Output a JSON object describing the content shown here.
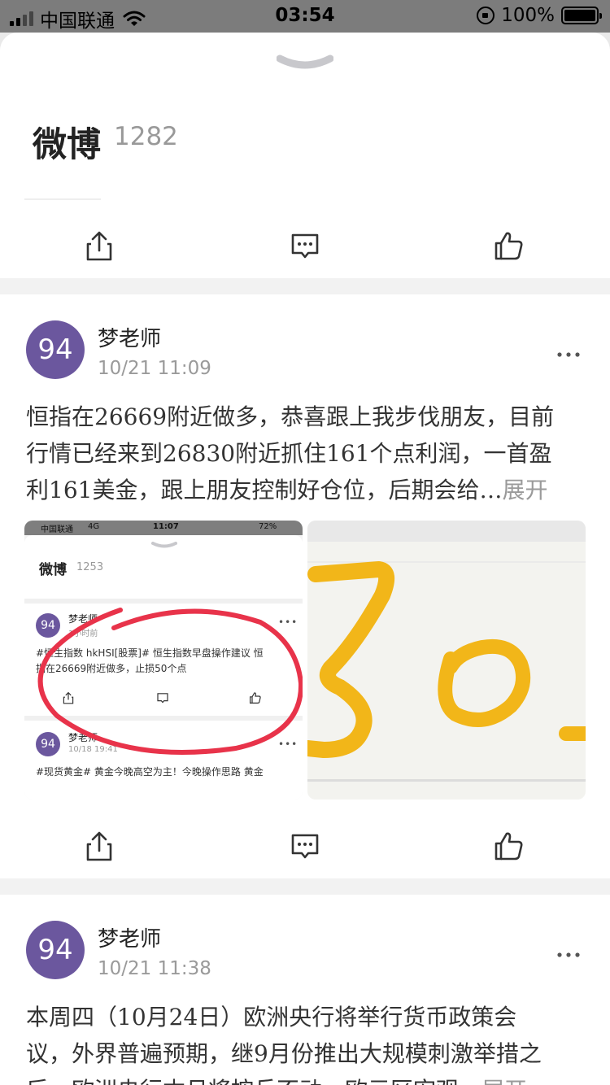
{
  "status_bar": {
    "carrier": "中国联通",
    "time": "03:54",
    "battery": "100%"
  },
  "header": {
    "title": "微博",
    "count": "1282"
  },
  "posts": [
    {
      "avatar_text": "94",
      "author": "梦老师",
      "time": "10/21 11:09",
      "line1": "恒指在26669附近做多，恭喜跟上我步伐朋友，目前",
      "line2": "行情已经来到26830附近抓住161个点利润，一首盈",
      "line3": "利161美金，跟上朋友控制好仓位，后期会给…",
      "expand": "展开",
      "screenshot": {
        "status_carrier": "中国联通",
        "status_net": "4G",
        "status_time": "11:07",
        "status_battery": "72%",
        "title": "微博",
        "count": "1253",
        "post1_avatar": "94",
        "post1_author": "梦老师",
        "post1_time": "1小时前",
        "post1_line1": "#恒生指数 hkHSI[股票]# 恒生指数早盘操作建议 恒",
        "post1_line2": "指在26669附近做多，止损50个点",
        "post2_avatar": "94",
        "post2_author": "梦老师",
        "post2_time": "10/18 19:41",
        "post2_line1": "#现货黄金# 黄金今晚高空为主！今晚操作思路 黄金"
      }
    },
    {
      "avatar_text": "94",
      "author": "梦老师",
      "time": "10/21 11:38",
      "line1": "本周四（10月24日）欧洲央行将举行货币政策会",
      "line2": "议，外界普遍预期，继9月份推出大规模刺激举措之",
      "line3": "后，欧洲央行本月将按兵不动，欧元区宏观…",
      "expand": "展开"
    }
  ],
  "icons": {
    "share": "share-icon",
    "comment": "comment-icon",
    "like": "thumbs-up-icon",
    "more": "more-dots-icon",
    "collapse": "chevron-down-icon"
  }
}
